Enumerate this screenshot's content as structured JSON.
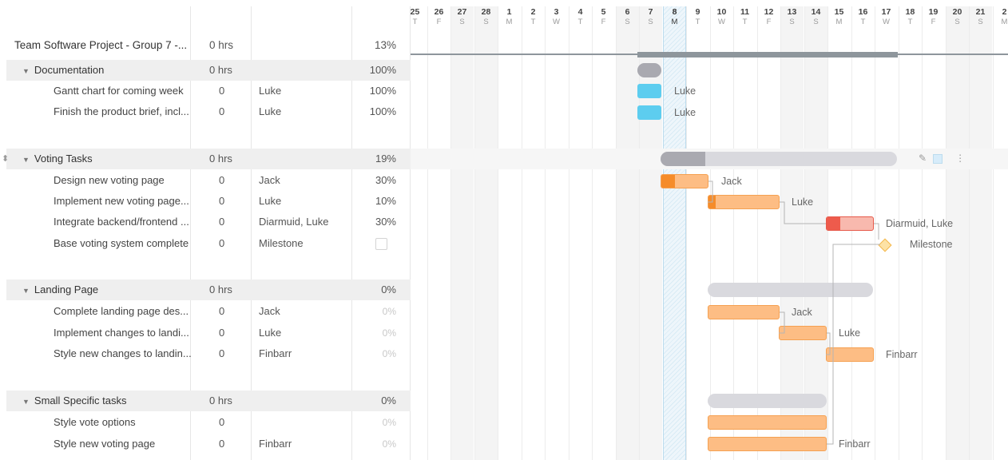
{
  "project": {
    "name": "Team Software Project - Group 7 -...",
    "hours": "0 hrs",
    "percent": "13%"
  },
  "groups": [
    {
      "name": "Documentation",
      "hours": "0 hrs",
      "percent": "100%",
      "tasks": [
        {
          "name": "Gantt chart for coming week",
          "hours": "0",
          "assignee": "Luke",
          "percent": "100%"
        },
        {
          "name": "Finish the product brief, incl...",
          "hours": "0",
          "assignee": "Luke",
          "percent": "100%"
        }
      ]
    },
    {
      "name": "Voting Tasks",
      "hours": "0 hrs",
      "percent": "19%",
      "tasks": [
        {
          "name": "Design new voting page",
          "hours": "0",
          "assignee": "Jack",
          "percent": "30%"
        },
        {
          "name": "Implement new voting page...",
          "hours": "0",
          "assignee": "Luke",
          "percent": "10%"
        },
        {
          "name": "Integrate backend/frontend ...",
          "hours": "0",
          "assignee": "Diarmuid, Luke",
          "percent": "30%"
        },
        {
          "name": "Base voting system complete",
          "hours": "0",
          "assignee": "Milestone",
          "percent": ""
        }
      ]
    },
    {
      "name": "Landing Page",
      "hours": "0 hrs",
      "percent": "0%",
      "tasks": [
        {
          "name": "Complete landing page des...",
          "hours": "0",
          "assignee": "Jack",
          "percent": "0%"
        },
        {
          "name": "Implement changes to landi...",
          "hours": "0",
          "assignee": "Luke",
          "percent": "0%"
        },
        {
          "name": "Style new changes to landin...",
          "hours": "0",
          "assignee": "Finbarr",
          "percent": "0%"
        }
      ]
    },
    {
      "name": "Small Specific tasks",
      "hours": "0 hrs",
      "percent": "0%",
      "tasks": [
        {
          "name": "Style vote options",
          "hours": "0",
          "assignee": "",
          "percent": "0%"
        },
        {
          "name": "Style new voting page",
          "hours": "0",
          "assignee": "Finbarr",
          "percent": "0%"
        }
      ]
    }
  ],
  "timeline": {
    "days": [
      {
        "n": "25",
        "d": "T"
      },
      {
        "n": "26",
        "d": "F"
      },
      {
        "n": "27",
        "d": "S"
      },
      {
        "n": "28",
        "d": "S"
      },
      {
        "n": "1",
        "d": "M"
      },
      {
        "n": "2",
        "d": "T"
      },
      {
        "n": "3",
        "d": "W"
      },
      {
        "n": "4",
        "d": "T"
      },
      {
        "n": "5",
        "d": "F"
      },
      {
        "n": "6",
        "d": "S"
      },
      {
        "n": "7",
        "d": "S"
      },
      {
        "n": "8",
        "d": "M"
      },
      {
        "n": "9",
        "d": "T"
      },
      {
        "n": "10",
        "d": "W"
      },
      {
        "n": "11",
        "d": "T"
      },
      {
        "n": "12",
        "d": "F"
      },
      {
        "n": "13",
        "d": "S"
      },
      {
        "n": "14",
        "d": "S"
      },
      {
        "n": "15",
        "d": "M"
      },
      {
        "n": "16",
        "d": "T"
      },
      {
        "n": "17",
        "d": "W"
      },
      {
        "n": "18",
        "d": "T"
      },
      {
        "n": "19",
        "d": "F"
      },
      {
        "n": "20",
        "d": "S"
      },
      {
        "n": "21",
        "d": "S"
      },
      {
        "n": "2",
        "d": "M"
      }
    ],
    "today": "8",
    "labels": {
      "doc1": "Luke",
      "doc2": "Luke",
      "vote1": "Jack",
      "vote2": "Luke",
      "vote3": "Diarmuid, Luke",
      "vote4": "Milestone",
      "land1": "Jack",
      "land2": "Luke",
      "land3": "Finbarr",
      "small2": "Finbarr"
    }
  },
  "icons": {
    "reorder": "drag-reorder-icon",
    "caret": "caret-down-icon",
    "edit": "pencil-icon",
    "color": "color-square-icon",
    "more": "more-vertical-icon"
  },
  "colors": {
    "bar_orange": "#fdbd84",
    "bar_progress": "#f58c2a",
    "bar_blue": "#5dcdef",
    "bar_red": "#f8b9ae",
    "group_bar": "#d9d9de"
  }
}
